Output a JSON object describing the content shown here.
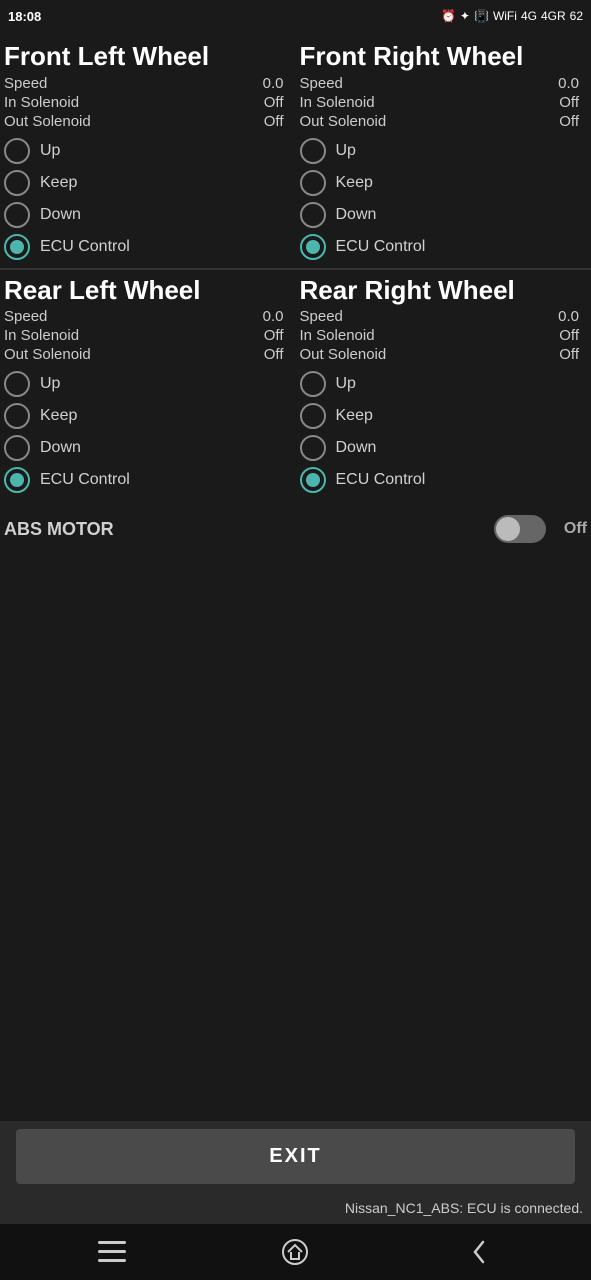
{
  "statusBar": {
    "time": "18:08",
    "rightIcons": "🔔 ★ 📳 ◌ 4G 4GR 62"
  },
  "wheels": {
    "frontLeft": {
      "title": "Front Left Wheel",
      "speed": {
        "label": "Speed",
        "value": "0.0"
      },
      "inSolenoid": {
        "label": "In Solenoid",
        "value": "Off"
      },
      "outSolenoid": {
        "label": "Out Solenoid",
        "value": "Off"
      },
      "options": [
        {
          "label": "Up",
          "selected": false
        },
        {
          "label": "Keep",
          "selected": false
        },
        {
          "label": "Down",
          "selected": false
        },
        {
          "label": "ECU Control",
          "selected": true
        }
      ]
    },
    "frontRight": {
      "title": "Front Right Wheel",
      "speed": {
        "label": "Speed",
        "value": "0.0"
      },
      "inSolenoid": {
        "label": "In Solenoid",
        "value": "Off"
      },
      "outSolenoid": {
        "label": "Out Solenoid",
        "value": "Off"
      },
      "options": [
        {
          "label": "Up",
          "selected": false
        },
        {
          "label": "Keep",
          "selected": false
        },
        {
          "label": "Down",
          "selected": false
        },
        {
          "label": "ECU Control",
          "selected": true
        }
      ]
    },
    "rearLeft": {
      "title": "Rear Left Wheel",
      "speed": {
        "label": "Speed",
        "value": "0.0"
      },
      "inSolenoid": {
        "label": "In Solenoid",
        "value": "Off"
      },
      "outSolenoid": {
        "label": "Out Solenoid",
        "value": "Off"
      },
      "options": [
        {
          "label": "Up",
          "selected": false
        },
        {
          "label": "Keep",
          "selected": false
        },
        {
          "label": "Down",
          "selected": false
        },
        {
          "label": "ECU Control",
          "selected": true
        }
      ]
    },
    "rearRight": {
      "title": "Rear Right Wheel",
      "speed": {
        "label": "Speed",
        "value": "0.0"
      },
      "inSolenoid": {
        "label": "In Solenoid",
        "value": "Off"
      },
      "outSolenoid": {
        "label": "Out Solenoid",
        "value": "Off"
      },
      "options": [
        {
          "label": "Up",
          "selected": false
        },
        {
          "label": "Keep",
          "selected": false
        },
        {
          "label": "Down",
          "selected": false
        },
        {
          "label": "ECU Control",
          "selected": true
        }
      ]
    }
  },
  "absMotor": {
    "label": "ABS MOTOR",
    "state": "Off",
    "enabled": false
  },
  "exitButton": {
    "label": "EXIT"
  },
  "ecuStatus": {
    "text": "Nissan_NC1_ABS: ECU is connected."
  },
  "navBar": {
    "menuIcon": "☰",
    "homeIcon": "⌂",
    "backIcon": "‹"
  }
}
